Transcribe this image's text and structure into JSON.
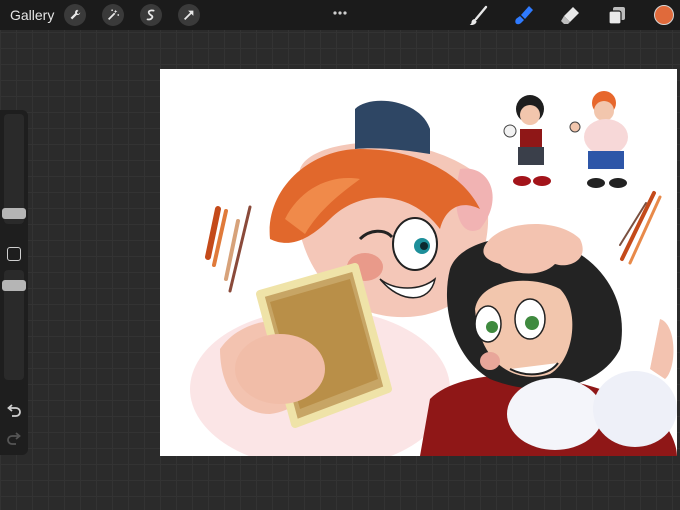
{
  "topbar": {
    "gallery_label": "Gallery",
    "left_tools": [
      "wrench-icon",
      "magic-wand-icon",
      "selection-icon",
      "transform-arrow-icon"
    ],
    "right_tools": [
      "brush-icon",
      "smudge-icon",
      "eraser-icon",
      "layers-icon"
    ],
    "more_icon": "ellipsis-icon",
    "active_tool_color": "#2f7bff",
    "current_color": "#e06a3b"
  },
  "sidebar": {
    "brush_size": 0.45,
    "opacity": 0.7,
    "undo_icon": "undo-icon",
    "redo_icon": "redo-icon",
    "modifier_icon": "modifier-square-icon"
  },
  "canvas": {
    "background": "#ffffff"
  }
}
